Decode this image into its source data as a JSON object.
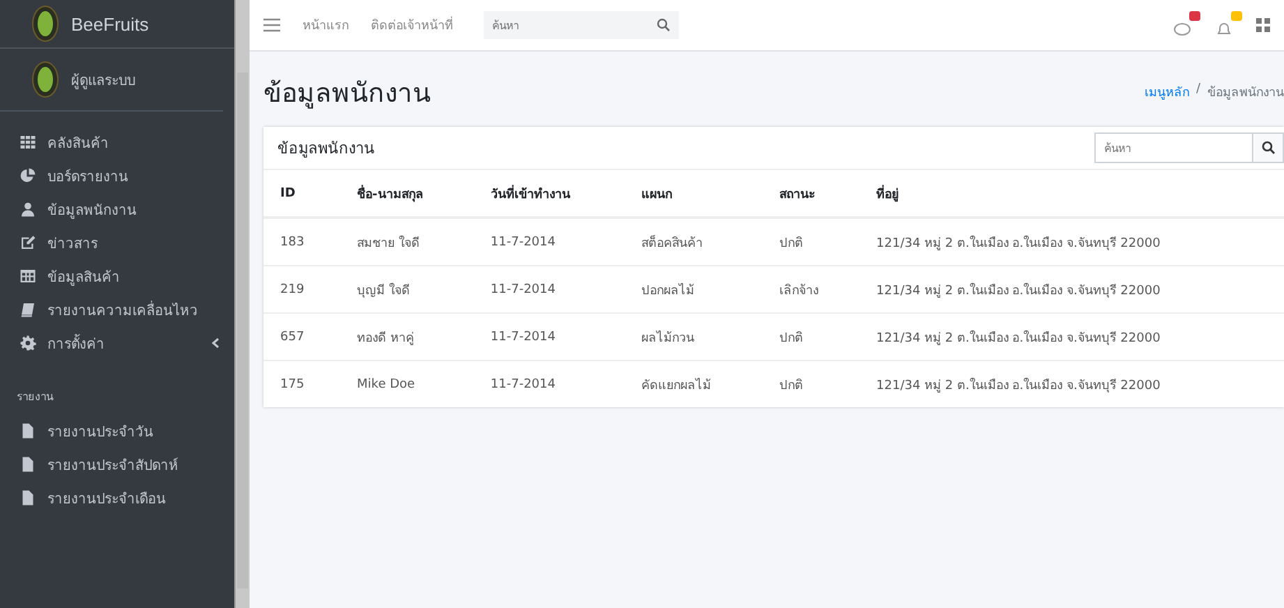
{
  "brand": {
    "name": "BeeFruits"
  },
  "user": {
    "name": "ผู้ดูแลระบบ"
  },
  "sidebar": {
    "items": [
      {
        "label": "คลังสินค้า",
        "has_submenu": false
      },
      {
        "label": "บอร์ดรายงาน",
        "has_submenu": false
      },
      {
        "label": "ข้อมูลพนักงาน",
        "has_submenu": false
      },
      {
        "label": "ข่าวสาร",
        "has_submenu": false
      },
      {
        "label": "ข้อมูลสินค้า",
        "has_submenu": false
      },
      {
        "label": "รายงานความเคลื่อนไหว",
        "has_submenu": false
      },
      {
        "label": "การตั้งค่า",
        "has_submenu": true
      }
    ],
    "section_header": "รายงาน",
    "report_items": [
      {
        "label": "รายงานประจำวัน"
      },
      {
        "label": "รายงานประจำสัปดาห์"
      },
      {
        "label": "รายงานประจำเดือน"
      }
    ]
  },
  "topbar": {
    "links": [
      "หน้าแรก",
      "ติดต่อเจ้าหน้าที่"
    ],
    "search": {
      "placeholder": "ค้นหา"
    },
    "notifications": [
      {
        "color": "#dc3545"
      },
      {
        "color": "#ffc107"
      }
    ]
  },
  "page": {
    "title": "ข้อมูลพนักงาน",
    "breadcrumb_separator": "/",
    "breadcrumb": [
      {
        "label": "เมนูหลัก",
        "link": true
      },
      {
        "label": "ข้อมูลพนักงาน",
        "link": false
      }
    ]
  },
  "card": {
    "title": "ข้อมูลพนักงาน",
    "search": {
      "placeholder": "ค้นหา"
    },
    "table": {
      "columns": [
        "ID",
        "ชื่อ-นามสกุล",
        "วันที่เข้าทำงาน",
        "แผนก",
        "สถานะ",
        "ที่อยู่"
      ],
      "rows": [
        [
          "183",
          "สมชาย ใจดี",
          "11-7-2014",
          "สต็อคสินค้า",
          "ปกติ",
          "121/34 หมู่ 2 ต.ในเมือง อ.ในเมือง จ.จันทบุรี 22000"
        ],
        [
          "219",
          "บุญมี ใจดี",
          "11-7-2014",
          "ปอกผลไม้",
          "เลิกจ้าง",
          "121/34 หมู่ 2 ต.ในเมือง อ.ในเมือง จ.จันทบุรี 22000"
        ],
        [
          "657",
          "ทองดี หาคู่",
          "11-7-2014",
          "ผลไม้กวน",
          "ปกติ",
          "121/34 หมู่ 2 ต.ในเมือง อ.ในเมือง จ.จันทบุรี 22000"
        ],
        [
          "175",
          "Mike Doe",
          "11-7-2014",
          "คัดแยกผลไม้",
          "ปกติ",
          "121/34 หมู่ 2 ต.ในเมือง อ.ในเมือง จ.จันทบุรี 22000"
        ]
      ]
    }
  }
}
